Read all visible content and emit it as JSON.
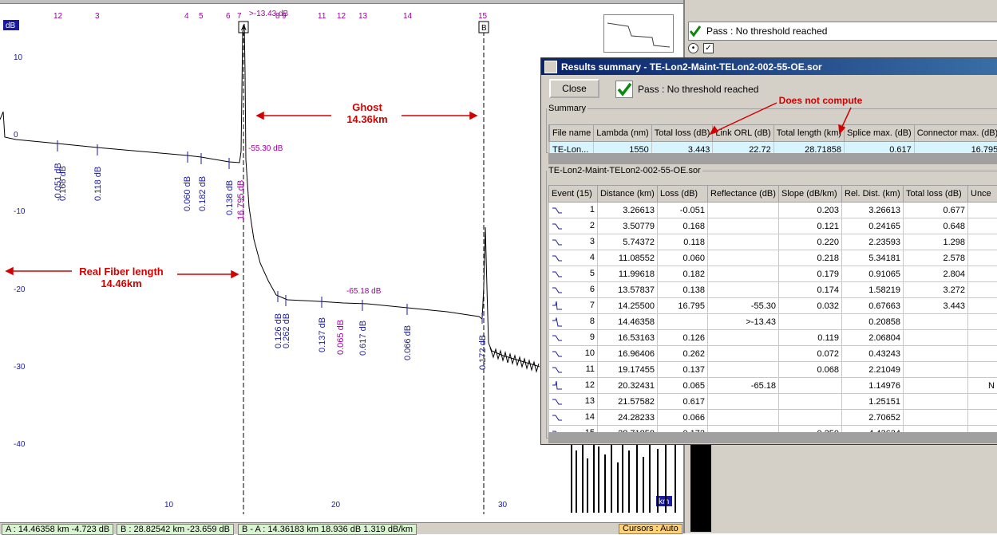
{
  "window": {
    "title": "Results summary - TE-Lon2-Maint-TELon2-002-55-OE.sor",
    "close_label": "Close",
    "pass_text": "Pass : No threshold reached"
  },
  "side_panel": {
    "pass_text": "Pass : No threshold reached"
  },
  "summary": {
    "legend": "Summary",
    "columns": [
      "File name",
      "Lambda (nm)",
      "Total loss (dB)",
      "Link ORL (dB)",
      "Total length (km)",
      "Splice max. (dB)",
      "Connector max. (dB)"
    ],
    "row": [
      "TE-Lon...",
      "1550",
      "3.443",
      "22.72",
      "28.71858",
      "0.617",
      "16.795"
    ]
  },
  "events": {
    "legend": "TE-Lon2-Maint-TELon2-002-55-OE.sor",
    "columns": [
      "Event (15)",
      "Distance (km)",
      "Loss (dB)",
      "Reflectance (dB)",
      "Slope (dB/km)",
      "Rel. Dist. (km)",
      "Total loss (dB)",
      "Unce"
    ],
    "rows": [
      {
        "n": "1",
        "dist": "3.26613",
        "loss": "-0.051",
        "refl": "",
        "slope": "0.203",
        "rel": "3.26613",
        "total": "0.677",
        "unc": "",
        "icon": "step"
      },
      {
        "n": "2",
        "dist": "3.50779",
        "loss": "0.168",
        "refl": "",
        "slope": "0.121",
        "rel": "0.24165",
        "total": "0.648",
        "unc": "",
        "icon": "step"
      },
      {
        "n": "3",
        "dist": "5.74372",
        "loss": "0.118",
        "refl": "",
        "slope": "0.220",
        "rel": "2.23593",
        "total": "1.298",
        "unc": "",
        "icon": "step"
      },
      {
        "n": "4",
        "dist": "11.08552",
        "loss": "0.060",
        "refl": "",
        "slope": "0.218",
        "rel": "5.34181",
        "total": "2.578",
        "unc": "",
        "icon": "step"
      },
      {
        "n": "5",
        "dist": "11.99618",
        "loss": "0.182",
        "refl": "",
        "slope": "0.179",
        "rel": "0.91065",
        "total": "2.804",
        "unc": "",
        "icon": "step"
      },
      {
        "n": "6",
        "dist": "13.57837",
        "loss": "0.138",
        "refl": "",
        "slope": "0.174",
        "rel": "1.58219",
        "total": "3.272",
        "unc": "",
        "icon": "step"
      },
      {
        "n": "7",
        "dist": "14.25500",
        "loss": "16.795",
        "refl": "-55.30",
        "slope": "0.032",
        "rel": "0.67663",
        "total": "3.443",
        "unc": "",
        "icon": "reflect"
      },
      {
        "n": "8",
        "dist": "14.46358",
        "loss": "",
        "refl": ">-13.43",
        "slope": "",
        "rel": "0.20858",
        "total": "",
        "unc": "",
        "icon": "end"
      },
      {
        "n": "9",
        "dist": "16.53163",
        "loss": "0.126",
        "refl": "",
        "slope": "0.119",
        "rel": "2.06804",
        "total": "",
        "unc": "",
        "icon": "step"
      },
      {
        "n": "10",
        "dist": "16.96406",
        "loss": "0.262",
        "refl": "",
        "slope": "0.072",
        "rel": "0.43243",
        "total": "",
        "unc": "",
        "icon": "step"
      },
      {
        "n": "11",
        "dist": "19.17455",
        "loss": "0.137",
        "refl": "",
        "slope": "0.068",
        "rel": "2.21049",
        "total": "",
        "unc": "",
        "icon": "step"
      },
      {
        "n": "12",
        "dist": "20.32431",
        "loss": "0.065",
        "refl": "-65.18",
        "slope": "",
        "rel": "1.14976",
        "total": "",
        "unc": "N",
        "icon": "reflect"
      },
      {
        "n": "13",
        "dist": "21.57582",
        "loss": "0.617",
        "refl": "",
        "slope": "",
        "rel": "1.25151",
        "total": "",
        "unc": "",
        "icon": "step"
      },
      {
        "n": "14",
        "dist": "24.28233",
        "loss": "0.066",
        "refl": "",
        "slope": "",
        "rel": "2.70652",
        "total": "",
        "unc": "",
        "icon": "step"
      },
      {
        "n": "15",
        "dist": "28.71858",
        "loss": "0.172",
        "refl": "",
        "slope": "0.250",
        "rel": "4.43624",
        "total": "",
        "unc": "",
        "icon": "step"
      }
    ]
  },
  "annotations": {
    "does_not_compute": "Does not compute",
    "ghost_line1": "Ghost",
    "ghost_line2": "14.36km",
    "real_line1": "Real Fiber length",
    "real_line2": "14.46km"
  },
  "trace": {
    "y_unit": "dB",
    "x_unit": "km",
    "y_ticks": [
      "10",
      "0",
      "-10",
      "-20",
      "-30",
      "-40"
    ],
    "x_ticks": [
      "10",
      "20",
      "30"
    ],
    "event_numbers": [
      "12",
      "3",
      "4",
      "5",
      "6",
      "7",
      "8",
      "9",
      "10",
      "11",
      "12",
      "13",
      "14",
      "15"
    ],
    "marker_a": "A",
    "marker_b": "B",
    "reflect_labels": [
      ">-13.43 dB",
      "-55.30 dB",
      "-65.18 dB"
    ],
    "loss_labels": [
      "-0.051 dB",
      "0.168 dB",
      "0.118 dB",
      "0.060 dB",
      "0.182 dB",
      "0.138 dB",
      "16.795 dB",
      "0.126 dB",
      "0.262 dB",
      "0.137 dB",
      "0.065 dB",
      "0.617 dB",
      "0.066 dB",
      "0.172 dB"
    ]
  },
  "status": {
    "a": "A : 14.46358 km  -4.723 dB",
    "b": "B : 28.82542 km  -23.659 dB",
    "ba": "B - A : 14.36183 km  18.936 dB  1.319 dB/km",
    "cursors": "Cursors : Auto"
  },
  "colors": {
    "trace": "#000000",
    "event_label": "#1a1aa0",
    "magenta": "#a000a0",
    "annotation": "#d40000",
    "title_start": "#0a246a"
  }
}
